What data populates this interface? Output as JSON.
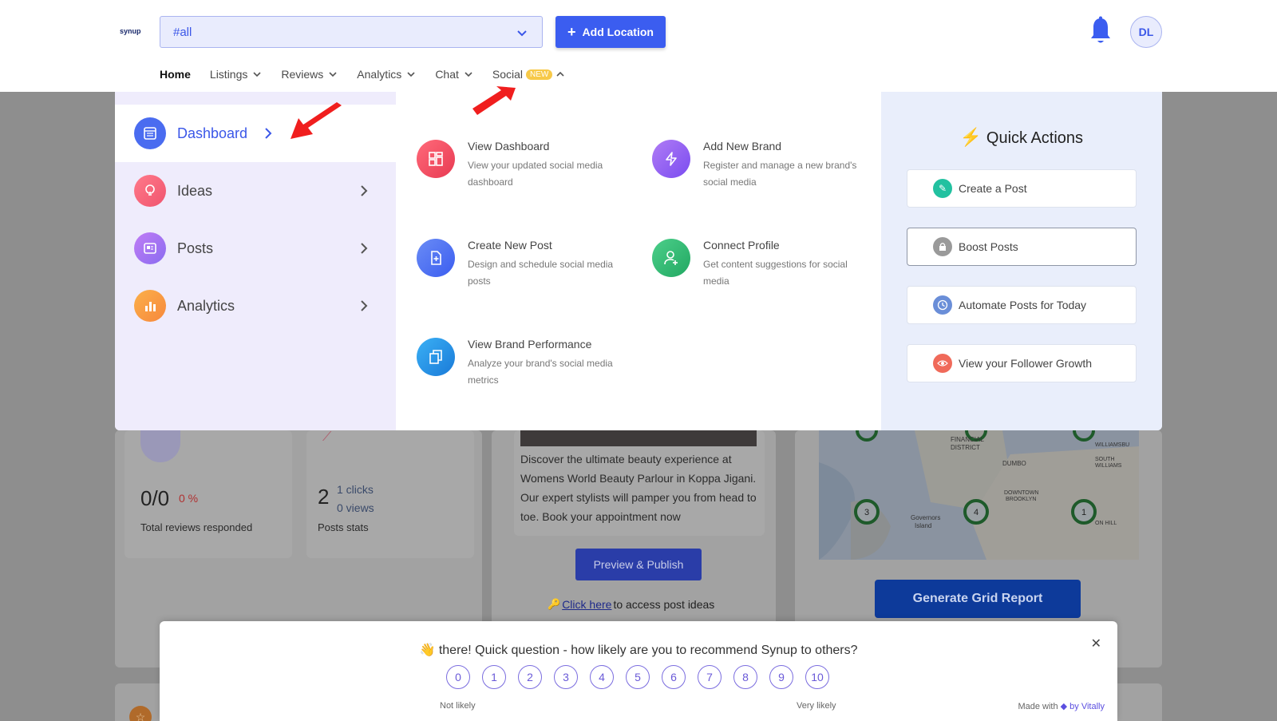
{
  "header": {
    "logo_text": "synup",
    "location_select": {
      "value": "#all"
    },
    "add_location_label": "Add Location",
    "avatar_initials": "DL"
  },
  "nav": {
    "items": [
      {
        "label": "Home"
      },
      {
        "label": "Listings"
      },
      {
        "label": "Reviews"
      },
      {
        "label": "Analytics"
      },
      {
        "label": "Chat"
      },
      {
        "label": "Social",
        "badge": "NEW"
      }
    ]
  },
  "mega_menu": {
    "sidebar": [
      {
        "label": "Dashboard",
        "icon": "dashboard-icon",
        "color": "#4a6cf0"
      },
      {
        "label": "Ideas",
        "icon": "lightbulb-icon",
        "color": "#f0546e"
      },
      {
        "label": "Posts",
        "icon": "posts-icon",
        "color": "#a56cf0"
      },
      {
        "label": "Analytics",
        "icon": "bar-chart-icon",
        "color": "#f79a3c"
      }
    ],
    "actions": [
      {
        "title": "View Dashboard",
        "desc": "View your updated social media dashboard",
        "icon": "grid-icon",
        "color": "#f04a5e"
      },
      {
        "title": "Add New Brand",
        "desc": "Register and manage a new brand's social media",
        "icon": "lightning-icon",
        "color": "#8a5cf0"
      },
      {
        "title": "Create New Post",
        "desc": "Design and schedule social media posts",
        "icon": "new-post-icon",
        "color": "#4a6cf0"
      },
      {
        "title": "Connect Profile",
        "desc": "Get content suggestions for social media",
        "icon": "add-user-icon",
        "color": "#2bb673"
      },
      {
        "title": "View Brand Performance",
        "desc": "Analyze your brand's social media metrics",
        "icon": "copy-icon",
        "color": "#1e96e8"
      }
    ],
    "quick_actions": {
      "title": "Quick Actions",
      "items": [
        {
          "label": "Create a Post",
          "icon": "create-post-icon",
          "color": "#22c1a0"
        },
        {
          "label": "Boost Posts",
          "icon": "lock-icon",
          "color": "#9a9a9a"
        },
        {
          "label": "Automate Posts for Today",
          "icon": "clock-icon",
          "color": "#6a8ed8"
        },
        {
          "label": "View your Follower Growth",
          "icon": "eye-icon",
          "color": "#f06a5a"
        }
      ]
    }
  },
  "background": {
    "reviews_stat": {
      "value": "0/0",
      "percent": "0 %",
      "label": "Total reviews responded"
    },
    "posts_stat": {
      "value": "2",
      "clicks": "1 clicks",
      "views": "0 views",
      "label": "Posts stats"
    },
    "post_preview": {
      "text": "Discover the ultimate beauty experience at Womens World Beauty Parlour in Koppa Jigani. Our expert stylists will pamper you from head to toe. Book your appointment now",
      "publish_label": "Preview & Publish",
      "link_text": "Click here",
      "link_suffix": " to access post ideas"
    },
    "grid_report_label": "Generate Grid Report",
    "map_labels": [
      "FINANCIAL DISTRICT",
      "DUMBO",
      "DOWNTOWN BROOKLYN",
      "Governors Island",
      "WILLIAMSBURG",
      "SOUTH WILLIAMSBURG",
      "CLINTON HILL"
    ],
    "map_pins": [
      "3",
      "4",
      "1"
    ]
  },
  "nps": {
    "question": "👋 there! Quick question - how likely are you to recommend Synup to others?",
    "scale": [
      "0",
      "1",
      "2",
      "3",
      "4",
      "5",
      "6",
      "7",
      "8",
      "9",
      "10"
    ],
    "low_label": "Not likely",
    "high_label": "Very likely",
    "made_with": "Made with",
    "by_vitally": "by Vitally"
  }
}
